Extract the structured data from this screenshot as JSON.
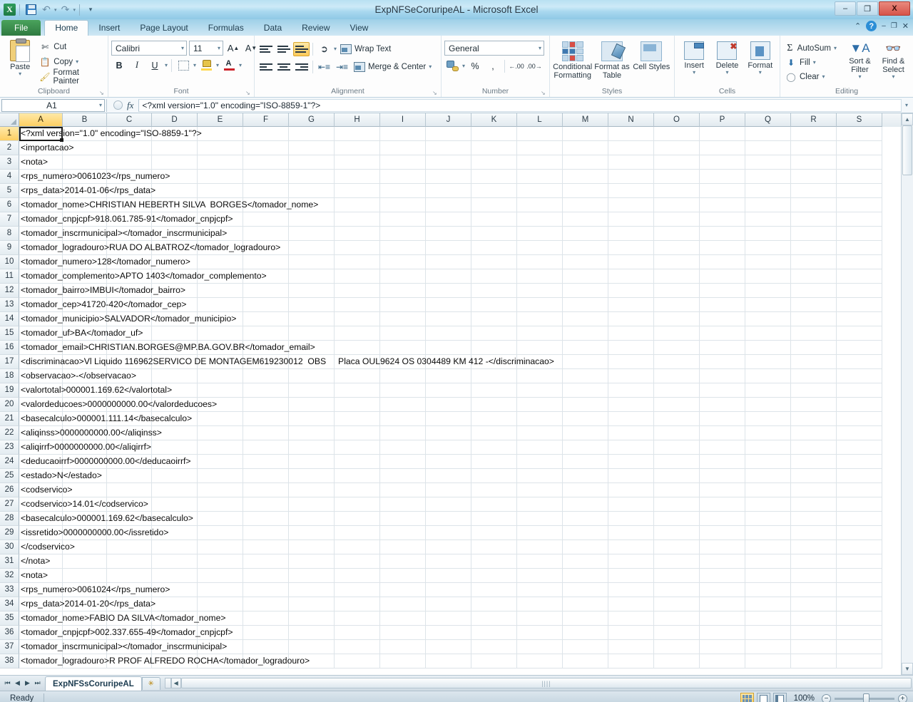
{
  "window": {
    "title": "ExpNFSeCoruripeAL  -  Microsoft Excel",
    "minimize": "–",
    "restore": "❐",
    "close": "X"
  },
  "qat": {
    "logo": "X",
    "save": "save-icon",
    "undo": "↶",
    "redo": "↷",
    "customize": "▾"
  },
  "ribbon_tabs": [
    {
      "label": "File"
    },
    {
      "label": "Home"
    },
    {
      "label": "Insert"
    },
    {
      "label": "Page Layout"
    },
    {
      "label": "Formulas"
    },
    {
      "label": "Data"
    },
    {
      "label": "Review"
    },
    {
      "label": "View"
    }
  ],
  "help_icons": {
    "collapse": "⌃",
    "help": "?",
    "win_min": "–",
    "win_restore": "❐",
    "win_close": "✕"
  },
  "clipboard": {
    "group_label": "Clipboard",
    "paste": "Paste",
    "cut": "Cut",
    "copy": "Copy",
    "format_painter": "Format Painter",
    "caret": "▾",
    "dialog_launcher": "↘"
  },
  "font": {
    "group_label": "Font",
    "family": "Calibri",
    "size": "11",
    "grow": "A",
    "shrink": "A",
    "bold": "B",
    "italic": "I",
    "underline": "U",
    "borders": "borders-icon",
    "fill_color": "fill-color-icon",
    "font_color": "A",
    "caret": "▾",
    "dialog_launcher": "↘"
  },
  "alignment": {
    "group_label": "Alignment",
    "align_top": "align-top-icon",
    "align_middle": "align-middle-icon",
    "align_bottom": "align-bottom-icon",
    "orientation": "orientation-icon",
    "wrap_text": "Wrap Text",
    "align_left": "align-left-icon",
    "align_center": "align-center-icon",
    "align_right": "align-right-icon",
    "decrease_indent": "decrease-indent-icon",
    "increase_indent": "increase-indent-icon",
    "merge_center": "Merge & Center",
    "caret": "▾",
    "dialog_launcher": "↘"
  },
  "number": {
    "group_label": "Number",
    "format": "General",
    "accounting": "accounting-icon",
    "percent": "%",
    "comma": ",",
    "increase_decimal": ".00",
    "decrease_decimal": ".00",
    "caret": "▾",
    "dialog_launcher": "↘"
  },
  "styles": {
    "group_label": "Styles",
    "conditional_formatting": "Conditional Formatting",
    "format_as_table": "Format as Table",
    "cell_styles": "Cell Styles",
    "caret": "▾"
  },
  "cells": {
    "group_label": "Cells",
    "insert": "Insert",
    "delete": "Delete",
    "format": "Format",
    "caret": "▾"
  },
  "editing": {
    "group_label": "Editing",
    "autosum": "AutoSum",
    "autosum_symbol": "Σ",
    "fill": "Fill",
    "clear": "Clear",
    "sort_filter": "Sort & Filter",
    "find_select": "Find & Select",
    "caret": "▾"
  },
  "formula_bar": {
    "name_box": "A1",
    "name_box_caret": "▾",
    "cancel": "✕",
    "enter": "✓",
    "insert_function": "fx",
    "value": "<?xml version=\"1.0\" encoding=\"ISO-8859-1\"?>",
    "expand": "▾"
  },
  "grid": {
    "columns": [
      "A",
      "B",
      "C",
      "D",
      "E",
      "F",
      "G",
      "H",
      "I",
      "J",
      "K",
      "L",
      "M",
      "N",
      "O",
      "P",
      "Q",
      "R",
      "S"
    ],
    "selected_column": "A",
    "selected_row": 1,
    "active_cell": "A1",
    "rows": [
      {
        "n": 1,
        "text": "<?xml version=\"1.0\" encoding=\"ISO-8859-1\"?>"
      },
      {
        "n": 2,
        "text": "<importacao>"
      },
      {
        "n": 3,
        "text": "<nota>"
      },
      {
        "n": 4,
        "text": "<rps_numero>0061023</rps_numero>"
      },
      {
        "n": 5,
        "text": "<rps_data>2014-01-06</rps_data>"
      },
      {
        "n": 6,
        "text": "<tomador_nome>CHRISTIAN HEBERTH SILVA  BORGES</tomador_nome>"
      },
      {
        "n": 7,
        "text": "<tomador_cnpjcpf>918.061.785-91</tomador_cnpjcpf>"
      },
      {
        "n": 8,
        "text": "<tomador_inscrmunicipal></tomador_inscrmunicipal>"
      },
      {
        "n": 9,
        "text": "<tomador_logradouro>RUA DO ALBATROZ</tomador_logradouro>"
      },
      {
        "n": 10,
        "text": "<tomador_numero>128</tomador_numero>"
      },
      {
        "n": 11,
        "text": "<tomador_complemento>APTO 1403</tomador_complemento>"
      },
      {
        "n": 12,
        "text": "<tomador_bairro>IMBUI</tomador_bairro>"
      },
      {
        "n": 13,
        "text": "<tomador_cep>41720-420</tomador_cep>"
      },
      {
        "n": 14,
        "text": "<tomador_municipio>SALVADOR</tomador_municipio>"
      },
      {
        "n": 15,
        "text": "<tomador_uf>BA</tomador_uf>"
      },
      {
        "n": 16,
        "text": "<tomador_email>CHRISTIAN.BORGES@MP.BA.GOV.BR</tomador_email>"
      },
      {
        "n": 17,
        "text": "<discriminacao>Vl Liquido 116962SERVICO DE MONTAGEM619230012  OBS     Placa OUL9624 OS 0304489 KM 412 -</discriminacao>"
      },
      {
        "n": 18,
        "text": "<observacao>-</observacao>"
      },
      {
        "n": 19,
        "text": "<valortotal>000001.169.62</valortotal>"
      },
      {
        "n": 20,
        "text": "<valordeducoes>0000000000.00</valordeducoes>"
      },
      {
        "n": 21,
        "text": "<basecalculo>000001.111.14</basecalculo>"
      },
      {
        "n": 22,
        "text": "<aliqinss>0000000000.00</aliqinss>"
      },
      {
        "n": 23,
        "text": "<aliqirrf>0000000000.00</aliqirrf>"
      },
      {
        "n": 24,
        "text": "<deducaoirrf>0000000000.00</deducaoirrf>"
      },
      {
        "n": 25,
        "text": "<estado>N</estado>"
      },
      {
        "n": 26,
        "text": "<codservico>"
      },
      {
        "n": 27,
        "text": "<codservico>14.01</codservico>"
      },
      {
        "n": 28,
        "text": "<basecalculo>000001.169.62</basecalculo>"
      },
      {
        "n": 29,
        "text": "<issretido>0000000000.00</issretido>"
      },
      {
        "n": 30,
        "text": "</codservico>"
      },
      {
        "n": 31,
        "text": "</nota>"
      },
      {
        "n": 32,
        "text": "<nota>"
      },
      {
        "n": 33,
        "text": "<rps_numero>0061024</rps_numero>"
      },
      {
        "n": 34,
        "text": "<rps_data>2014-01-20</rps_data>"
      },
      {
        "n": 35,
        "text": "<tomador_nome>FABIO DA SILVA</tomador_nome>"
      },
      {
        "n": 36,
        "text": "<tomador_cnpjcpf>002.337.655-49</tomador_cnpjcpf>"
      },
      {
        "n": 37,
        "text": "<tomador_inscrmunicipal></tomador_inscrmunicipal>"
      },
      {
        "n": 38,
        "text": "<tomador_logradouro>R PROF ALFREDO ROCHA</tomador_logradouro>"
      }
    ]
  },
  "sheet_tabs": {
    "first": "⏮",
    "prev": "◀",
    "next": "▶",
    "last": "⏭",
    "active_sheet": "ExpNFSsCoruripeAL",
    "new_sheet": "✳"
  },
  "status_bar": {
    "status": "Ready",
    "view_normal": "normal-view-icon",
    "view_page_layout": "page-layout-view-icon",
    "view_page_break": "page-break-view-icon",
    "zoom": "100%",
    "zoom_out": "−",
    "zoom_in": "+"
  }
}
